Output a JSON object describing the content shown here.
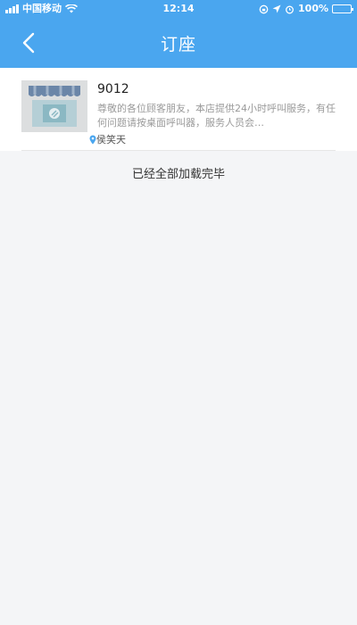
{
  "status_bar": {
    "carrier": "中国移动",
    "time": "12:14",
    "battery": "100%"
  },
  "nav": {
    "title": "订座"
  },
  "shop": {
    "name": "9012",
    "description": "尊敬的各位顾客朋友，本店提供24小时呼叫服务，有任何问题请按桌面呼叫器，服务人员会…",
    "location": "侯笑天"
  },
  "footer": {
    "text": "已经全部加载完毕"
  },
  "colors": {
    "header": "#4aa6ef",
    "background": "#f4f5f7",
    "location_pin": "#4aa6ef"
  }
}
